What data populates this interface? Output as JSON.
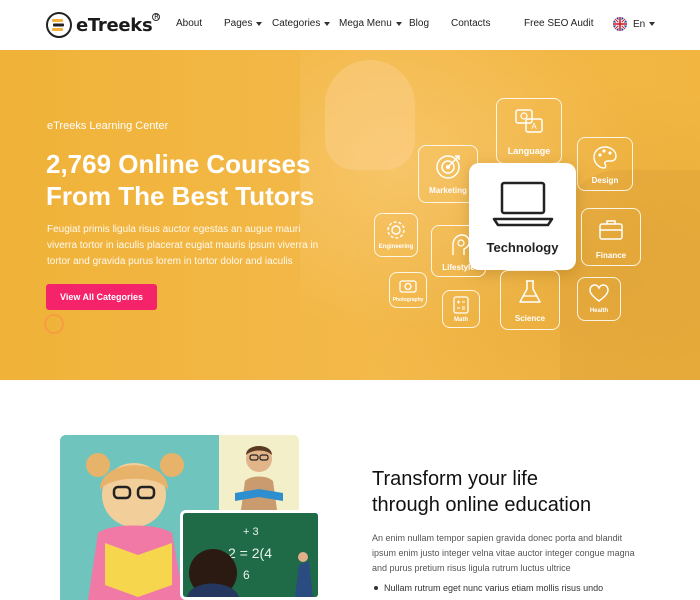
{
  "header": {
    "logo_text": "eTreeks",
    "logo_reg": "R",
    "nav": [
      {
        "label": "About",
        "has_caret": false
      },
      {
        "label": "Pages",
        "has_caret": true
      },
      {
        "label": "Categories",
        "has_caret": true
      },
      {
        "label": "Mega Menu",
        "has_caret": true
      },
      {
        "label": "Blog",
        "has_caret": false
      },
      {
        "label": "Contacts",
        "has_caret": false
      }
    ],
    "seo_audit": "Free SEO Audit",
    "language": "En"
  },
  "hero": {
    "eyebrow": "eTreeks Learning Center",
    "title_line1": "2,769 Online Courses",
    "title_line2": "From The Best Tutors",
    "description": "Feugiat primis ligula risus auctor egestas an augue mauri viverra tortor in iaculis placerat eugiat mauris ipsum viverra in tortor and gravida purus lorem in tortor dolor and iaculis",
    "button_label": "View All Categories",
    "categories": {
      "language": "Language",
      "marketing": "Marketing",
      "design": "Design",
      "technology": "Technology",
      "engineering": "Engineering",
      "lifestyle": "Lifestyle",
      "finance": "Finance",
      "photography": "Photography",
      "math": "Math",
      "science": "Science",
      "health": "Health"
    }
  },
  "about": {
    "title_line1": "Transform your life",
    "title_line2": "through online education",
    "description": "An enim nullam tempor sapien gravida donec porta and blandit ipsum enim justo integer velna vitae auctor integer congue magna and purus pretium risus ligula rutrum luctus ultrice",
    "bullet": "Nullam rutrum eget nunc varius etiam mollis risus undo"
  },
  "colors": {
    "hero_bg": "#f1b540",
    "accent": "#f4236a",
    "text_dark": "#111111"
  }
}
